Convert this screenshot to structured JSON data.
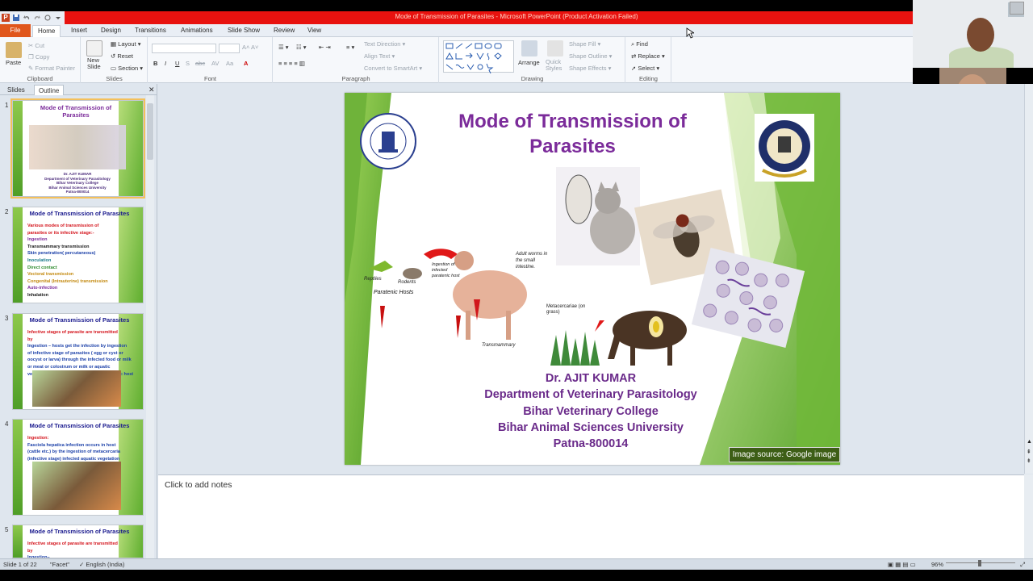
{
  "window": {
    "title": "Mode of Transmission of Parasites  -  Microsoft PowerPoint (Product Activation Failed)",
    "app_icon_letter": "P"
  },
  "tabs": [
    "File",
    "Home",
    "Insert",
    "Design",
    "Transitions",
    "Animations",
    "Slide Show",
    "Review",
    "View"
  ],
  "ribbon": {
    "clipboard": {
      "label": "Clipboard",
      "paste": "Paste",
      "cut": "Cut",
      "copy": "Copy",
      "format_painter": "Format Painter"
    },
    "slides": {
      "label": "Slides",
      "new_slide": "New Slide",
      "layout": "Layout",
      "reset": "Reset",
      "section": "Section"
    },
    "font": {
      "label": "Font"
    },
    "paragraph": {
      "label": "Paragraph",
      "text_direction": "Text Direction",
      "align_text": "Align Text",
      "convert_smartart": "Convert to SmartArt"
    },
    "drawing": {
      "label": "Drawing",
      "arrange": "Arrange",
      "quick_styles": "Quick Styles",
      "shape_fill": "Shape Fill",
      "shape_outline": "Shape Outline",
      "shape_effects": "Shape Effects"
    },
    "editing": {
      "label": "Editing",
      "find": "Find",
      "replace": "Replace",
      "select": "Select"
    }
  },
  "panel": {
    "tab_slides": "Slides",
    "tab_outline": "Outline",
    "thumbnails": [
      {
        "num": "1",
        "title": "Mode of Transmission of Parasites",
        "lines": []
      },
      {
        "num": "2",
        "title": "Mode of Transmission of Parasites",
        "lines": [
          {
            "text": "Various modes of transmission of",
            "color": "#d4141c"
          },
          {
            "text": "parasites or its infective stage:-",
            "color": "#d4141c"
          },
          {
            "text": "Ingestion",
            "color": "#7b2b9a"
          },
          {
            "text": "Transmammary transmission",
            "color": "#1a1a1a"
          },
          {
            "text": "Skin penetration( percutaneous)",
            "color": "#1a3fa8"
          },
          {
            "text": "Inoculation",
            "color": "#1a7a8a"
          },
          {
            "text": "Direct contact",
            "color": "#2c8a2c"
          },
          {
            "text": "Vectoral transmission",
            "color": "#c48a10"
          },
          {
            "text": "Congenital (Intrauterine) transmission",
            "color": "#c48a10"
          },
          {
            "text": "Auto-infection",
            "color": "#7b2b9a"
          },
          {
            "text": "Inhalation",
            "color": "#1a1a1a"
          }
        ]
      },
      {
        "num": "3",
        "title": "Mode of Transmission of Parasites",
        "lines": [
          {
            "text": "Infective stages of parasite are transmitted",
            "color": "#d4141c"
          },
          {
            "text": "by",
            "color": "#d4141c"
          },
          {
            "text": "Ingestion – hosts get the infection by ingestion",
            "color": "#1a3fa8"
          },
          {
            "text": "of infective stage of parasites ( egg or cyst or",
            "color": "#1a3fa8"
          },
          {
            "text": "oocyst or larva) through the infected food or milk",
            "color": "#1a3fa8"
          },
          {
            "text": "or meat or colostrum or milk or aquatic",
            "color": "#1a3fa8"
          },
          {
            "text": "vegetations or intermediate host or paratenic host",
            "color": "#1a3fa8"
          }
        ]
      },
      {
        "num": "4",
        "title": "Mode of Transmission of Parasites",
        "lines": [
          {
            "text": "Ingestion:",
            "color": "#d4141c"
          },
          {
            "text": "Fasciola hepatica infection occurs in host",
            "color": "#1a3fa8"
          },
          {
            "text": "(cattle etc.) by the ingestion of metacercaria",
            "color": "#1a3fa8"
          },
          {
            "text": "(infective stage) infected aquatic vegetation",
            "color": "#1a3fa8"
          }
        ]
      },
      {
        "num": "5",
        "title": "Mode of Transmission of Parasites",
        "lines": [
          {
            "text": "Infective stages of parasite are transmitted",
            "color": "#d4141c"
          },
          {
            "text": "by",
            "color": "#d4141c"
          },
          {
            "text": "Ingestion–",
            "color": "#1a3fa8"
          }
        ]
      }
    ]
  },
  "slide": {
    "title_line1": "Mode of Transmission of",
    "title_line2": "Parasites",
    "credits": [
      "Dr. AJIT KUMAR",
      "Department of Veterinary Parasitology",
      "Bihar Veterinary College",
      "Bihar Animal Sciences University",
      "Patna-800014"
    ],
    "image_source": "Image source: Google image",
    "annotations": {
      "reptiles": "Reptiles",
      "rodents": "Rodents",
      "paratenic_hosts": "Paratenic Hosts",
      "ingestion": "Ingestion of infected paratenic host",
      "adult_worms": "Adult worms in the small intestine.",
      "metacercariae": "Metacercariae (on grass)",
      "transmammary": "Transmammary"
    }
  },
  "notes": {
    "placeholder": "Click to add notes"
  },
  "status": {
    "slide_of": "Slide 1 of 22",
    "theme": "\"Facet\"",
    "language": "English (India)",
    "zoom": "96%"
  }
}
